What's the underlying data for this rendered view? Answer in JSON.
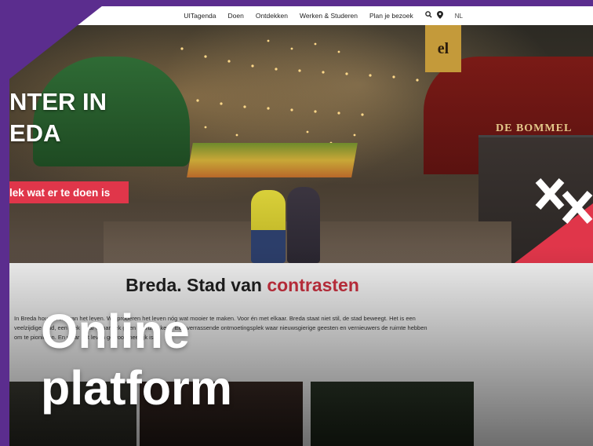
{
  "nav": {
    "items": [
      "UITagenda",
      "Doen",
      "Ontdekken",
      "Werken & Studeren",
      "Plan je bezoek"
    ],
    "search_icon": "search-icon",
    "location_icon": "location-pin-icon",
    "language": "NL"
  },
  "hero": {
    "title": "NTER IN\nEDA",
    "cta_label": "lek wat er te doen is",
    "sign_shop": "DE BOMMEL",
    "sign_elf": "el",
    "accent_color": "#e0364a"
  },
  "content": {
    "title_prefix": "Breda. Stad van ",
    "title_accent": "contrasten",
    "body": "In Breda houden we van het leven. We proberen het leven nóg wat mooier te maken. Voor én met elkaar. Breda staat niet stil, de stad beweegt. Het is een veelzijdige stad, een plek waar dynamiek geen grenzen kent. Een verrassende ontmoetingsplek waar nieuwsgierige geesten en vernieuwers de ruimte hebben om te pionieren. En waar het leven gewoon heerlijk is."
  },
  "overlay": {
    "title": "Online\nplatform",
    "brand_color": "#5b2d8e"
  }
}
